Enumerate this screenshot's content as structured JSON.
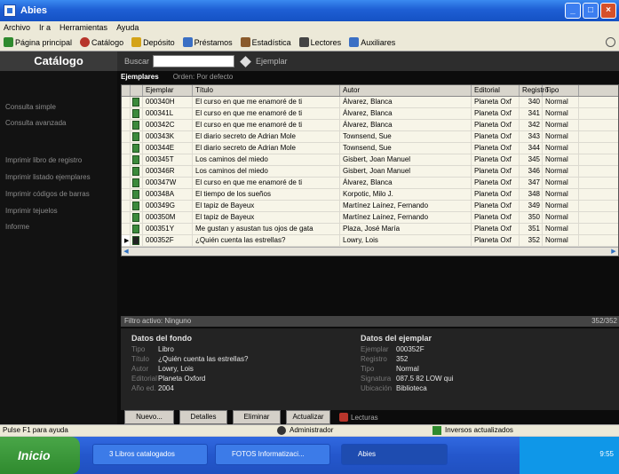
{
  "window": {
    "title": "Abies"
  },
  "menu": [
    "Archivo",
    "Ir a",
    "Herramientas",
    "Ayuda"
  ],
  "toolbar": [
    {
      "label": "Página principal",
      "icon": "home-icon",
      "color": "#2f8a2e"
    },
    {
      "label": "Catálogo",
      "icon": "catalog-icon",
      "color": "#b7352b"
    },
    {
      "label": "Depósito",
      "icon": "deposit-icon",
      "color": "#d4a317"
    },
    {
      "label": "Préstamos",
      "icon": "loans-icon",
      "color": "#3a6fc4"
    },
    {
      "label": "Estadística",
      "icon": "stats-icon",
      "color": "#8a5a2b"
    },
    {
      "label": "Lectores",
      "icon": "readers-icon",
      "color": "#444444"
    },
    {
      "label": "Auxiliares",
      "icon": "auxiliary-icon",
      "color": "#3a6fc4"
    }
  ],
  "sidebar": {
    "title": "Catálogo",
    "items": [
      "Consulta simple",
      "Consulta avanzada",
      "Imprimir libro de registro",
      "Imprimir listado ejemplares",
      "Imprimir códigos de barras",
      "Imprimir tejuelos",
      "Informe"
    ]
  },
  "search": {
    "label": "Buscar",
    "value": "",
    "option": "Ejemplar"
  },
  "tabs": {
    "active": "Ejemplares",
    "order": "Orden: Por defecto"
  },
  "grid": {
    "columns": [
      "Ejemplar",
      "Título",
      "Autor",
      "Editorial",
      "Registro",
      "Tipo"
    ],
    "rows": [
      [
        "000340H",
        "El curso en que me enamoré de ti",
        "Álvarez, Blanca",
        "Planeta Oxf",
        "340",
        "Normal"
      ],
      [
        "000341L",
        "El curso en que me enamoré de ti",
        "Álvarez, Blanca",
        "Planeta Oxf",
        "341",
        "Normal"
      ],
      [
        "000342C",
        "El curso en que me enamoré de ti",
        "Álvarez, Blanca",
        "Planeta Oxf",
        "342",
        "Normal"
      ],
      [
        "000343K",
        "El diario secreto de Adrian Mole",
        "Townsend, Sue",
        "Planeta Oxf",
        "343",
        "Normal"
      ],
      [
        "000344E",
        "El diario secreto de Adrian Mole",
        "Townsend, Sue",
        "Planeta Oxf",
        "344",
        "Normal"
      ],
      [
        "000345T",
        "Los caminos del miedo",
        "Gisbert, Joan Manuel",
        "Planeta Oxf",
        "345",
        "Normal"
      ],
      [
        "000346R",
        "Los caminos del miedo",
        "Gisbert, Joan Manuel",
        "Planeta Oxf",
        "346",
        "Normal"
      ],
      [
        "000347W",
        "El curso en que me enamoré de ti",
        "Álvarez, Blanca",
        "Planeta Oxf",
        "347",
        "Normal"
      ],
      [
        "000348A",
        "El tiempo de los sueños",
        "Korpotic, Milo J.",
        "Planeta Oxf",
        "348",
        "Normal"
      ],
      [
        "000349G",
        "El tapiz de Bayeux",
        "Martínez Laínez, Fernando",
        "Planeta Oxf",
        "349",
        "Normal"
      ],
      [
        "000350M",
        "El tapiz de Bayeux",
        "Martínez Laínez, Fernando",
        "Planeta Oxf",
        "350",
        "Normal"
      ],
      [
        "000351Y",
        "Me gustan y asustan tus ojos de gata",
        "Plaza, José María",
        "Planeta Oxf",
        "351",
        "Normal"
      ],
      [
        "000352F",
        "¿Quién cuenta las estrellas?",
        "Lowry, Lois",
        "Planeta Oxf",
        "352",
        "Normal"
      ]
    ]
  },
  "filter": {
    "label": "Filtro activo: Ninguno",
    "count": "352/352"
  },
  "fondo": {
    "title": "Datos del fondo",
    "fields": [
      {
        "label": "Tipo",
        "value": "Libro"
      },
      {
        "label": "Título",
        "value": "¿Quién cuenta las estrellas?"
      },
      {
        "label": "Autor",
        "value": "Lowry, Lois"
      },
      {
        "label": "Editorial",
        "value": "Planeta Oxford"
      },
      {
        "label": "Año ed.",
        "value": "2004"
      }
    ]
  },
  "ejemplar": {
    "title": "Datos del ejemplar",
    "fields": [
      {
        "label": "Ejemplar",
        "value": "000352F"
      },
      {
        "label": "Registro",
        "value": "352"
      },
      {
        "label": "Tipo",
        "value": "Normal"
      },
      {
        "label": "Signatura",
        "value": "087.5 82 LOW qui"
      },
      {
        "label": "Ubicación",
        "value": "Biblioteca"
      }
    ]
  },
  "buttons": [
    "Nuevo...",
    "Detalles",
    "Eliminar",
    "Actualizar"
  ],
  "lecturas": "Lecturas",
  "status": {
    "help": "Pulse F1 para ayuda",
    "user": "Administrador",
    "message": "Inversos actualizados"
  },
  "taskbar": {
    "start": "Inicio",
    "tasks": [
      "3 Libros catalogados",
      "FOTOS Informatizaci...",
      "Abies"
    ],
    "time": "9:55"
  }
}
